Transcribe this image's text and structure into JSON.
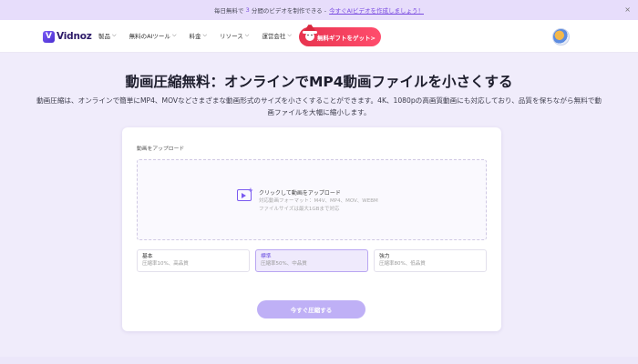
{
  "banner": {
    "text_a": "毎日無料で",
    "count": "3",
    "text_b": "分間",
    "text_c": "のビデオを制作できる -",
    "link": "今すぐAIビデオを作成しましょう！",
    "close": "×"
  },
  "nav": {
    "logo_mark": "V",
    "logo_text": "Vidnoz",
    "menu": [
      {
        "label": "製品"
      },
      {
        "label": "無料のAIツール"
      },
      {
        "label": "料金"
      },
      {
        "label": "リソース"
      },
      {
        "label": "運営会社"
      }
    ],
    "promo": "無料ギフトをゲット>"
  },
  "hero": {
    "title": "動画圧縮無料：オンラインでMP4動画ファイルを小さくする",
    "subtitle": "動画圧縮は、オンラインで簡単にMP4、MOVなどさまざまな動画形式のサイズを小さくすることができます。4K、1080pの高画質動画にも対応しており、品質を保ちながら無料で動画ファイルを大幅に縮小します。"
  },
  "upload": {
    "label": "動画をアップロード",
    "main": "クリックして動画をアップロード",
    "formats": "対応動画フォーマット：M4V、MP4、MOV、WEBM",
    "size_limit": "ファイルサイズは最大1GBまで対応"
  },
  "options": [
    {
      "name": "基本",
      "desc": "圧縮率10%、高品質",
      "selected": false
    },
    {
      "name": "標準",
      "desc": "圧縮率50%、中品質",
      "selected": true
    },
    {
      "name": "強力",
      "desc": "圧縮率80%、低品質",
      "selected": false
    }
  ],
  "action": {
    "compress_button": "今すぐ圧縮する"
  },
  "colors": {
    "accent": "#7a5af0",
    "button_disabled": "#bfb0f6",
    "promo": "#e8344f",
    "page_bg": "#f0ecfb"
  }
}
